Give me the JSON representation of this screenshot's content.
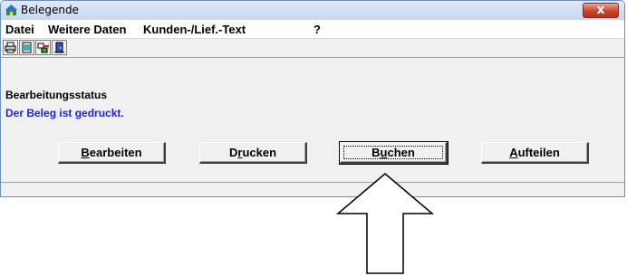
{
  "window": {
    "title": "Belegende",
    "close_label": "x"
  },
  "menu": [
    {
      "label": "Datei"
    },
    {
      "label": "Weitere Daten"
    },
    {
      "label": "Kunden-/Lief.-Text"
    },
    {
      "label": "?"
    }
  ],
  "toolbar": {
    "icons": [
      "printer-icon",
      "document-icon",
      "transfer-icon",
      "exit-door-icon"
    ]
  },
  "status": {
    "label": "Bearbeitungsstatus",
    "text": "Der Beleg ist gedruckt.",
    "text_color": "#2222dd"
  },
  "buttons": {
    "bearbeiten": {
      "label": "Bearbeiten",
      "mnemonic": "B"
    },
    "drucken": {
      "label": "Drucken",
      "mnemonic": "r"
    },
    "buchen": {
      "label": "Buchen",
      "mnemonic": "u"
    },
    "aufteilen": {
      "label": "Aufteilen",
      "mnemonic": "A"
    }
  },
  "annotation": {
    "arrow_icon": "up-arrow-annotation",
    "points_to": "Buchen"
  }
}
